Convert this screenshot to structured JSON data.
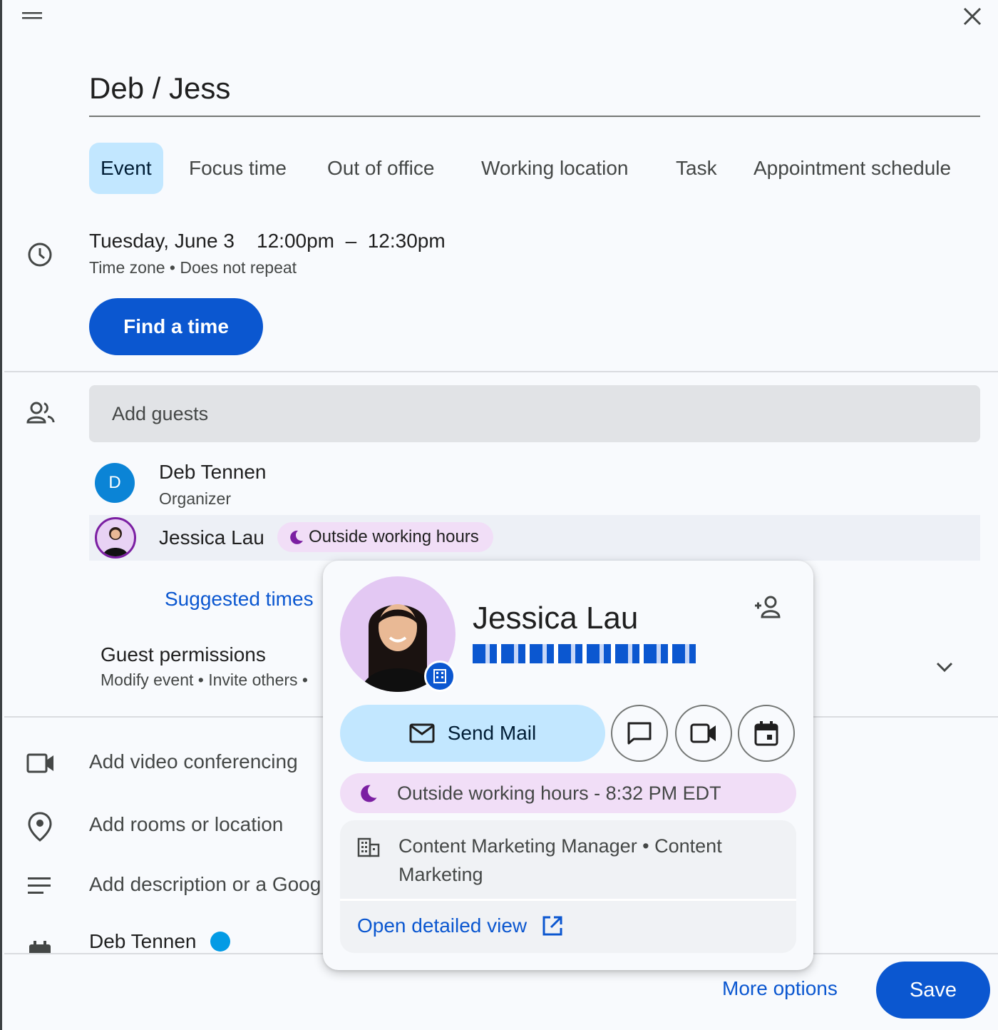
{
  "event": {
    "title": "Deb / Jess",
    "tabs": [
      "Event",
      "Focus time",
      "Out of office",
      "Working location",
      "Task",
      "Appointment schedule"
    ],
    "active_tab": "Event",
    "date": "Tuesday, June 3",
    "start_time": "12:00pm",
    "end_time": "12:30pm",
    "time_separator": "–",
    "time_zone": "Time zone",
    "repeat": "Does not repeat",
    "meta_separator": "•",
    "find_time_label": "Find a time"
  },
  "guests": {
    "placeholder": "Add guests",
    "list": [
      {
        "initial": "D",
        "name": "Deb Tennen",
        "role": "Organizer"
      },
      {
        "name": "Jessica Lau",
        "status": "Outside working hours"
      }
    ],
    "suggested_times": "Suggested times",
    "permissions_title": "Guest permissions",
    "permissions_detail": "Modify event • Invite others •"
  },
  "rows": {
    "video": "Add video conferencing",
    "location": "Add rooms or location",
    "description": "Add description or a Goog",
    "calendar_owner": "Deb Tennen",
    "calendar_color": "#039be5"
  },
  "footer": {
    "more_options": "More options",
    "save": "Save"
  },
  "profile_card": {
    "name": "Jessica Lau",
    "email_redacted": "▮▮▮▮▮▮▮▮▮▮▮▮▮▮▮▮▮▮▮▮▮▮",
    "send_mail": "Send Mail",
    "working_hours": "Outside working hours - 8:32 PM EDT",
    "job": "Content Marketing Manager • Content Marketing",
    "open_detailed_view": "Open detailed view"
  },
  "colors": {
    "primary": "#0b57d0",
    "tonal": "#c2e7ff",
    "status_purple": "#7b1fa2",
    "status_bg": "#f1def7"
  }
}
